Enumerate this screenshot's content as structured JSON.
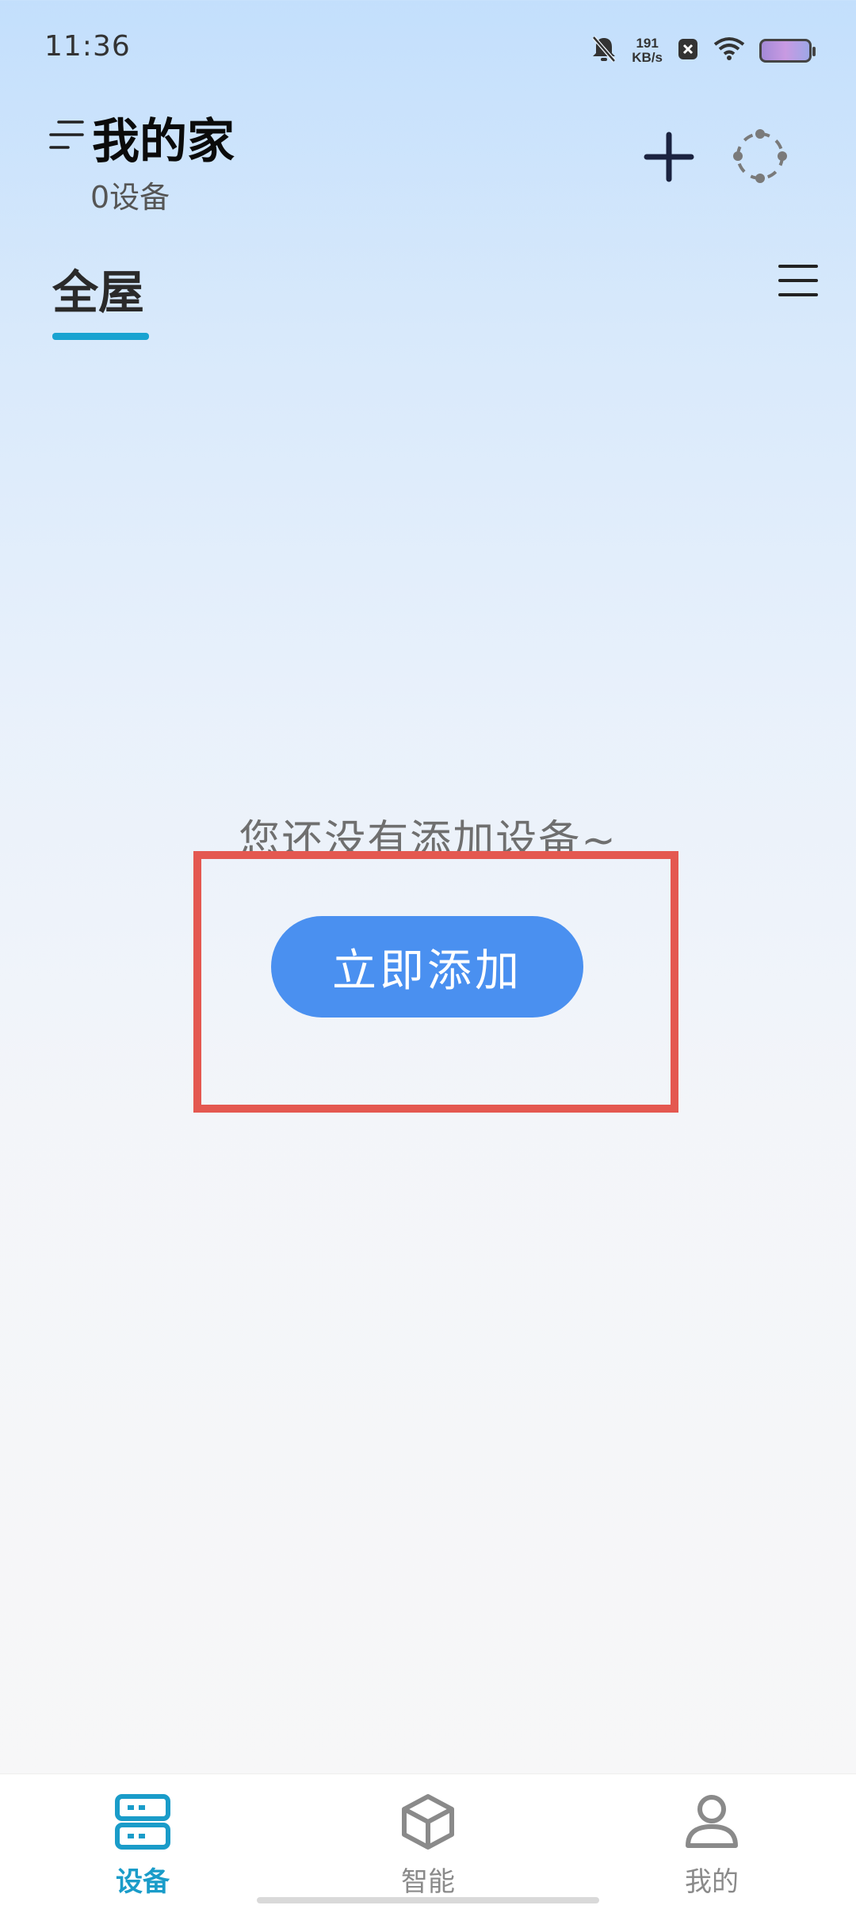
{
  "status_bar": {
    "time": "11:36",
    "net_speed_value": "191",
    "net_speed_unit": "KB/s",
    "icons": [
      "mute-bell-icon",
      "net-speed-indicator",
      "close-notification-icon",
      "wifi-icon",
      "battery-icon"
    ]
  },
  "header": {
    "home_name": "我的家",
    "device_count": "0设备",
    "add_icon": "plus-icon",
    "scan_icon": "scan-icon",
    "menu_icon": "menu-lines-icon"
  },
  "tabs": {
    "active": "全屋",
    "accent_color": "#19a3d1",
    "list_icon": "list-menu-icon"
  },
  "empty_state": {
    "message": "您还没有添加设备~",
    "button_label": "立即添加",
    "button_color": "#4a90f0",
    "highlight_color": "#e45850"
  },
  "bottom_nav": {
    "items": [
      {
        "label": "设备",
        "icon": "devices-icon",
        "active": true,
        "color": "#1a9cc9"
      },
      {
        "label": "智能",
        "icon": "cube-icon",
        "active": false,
        "color": "#8a8a8a"
      },
      {
        "label": "我的",
        "icon": "person-icon",
        "active": false,
        "color": "#8a8a8a"
      }
    ]
  }
}
